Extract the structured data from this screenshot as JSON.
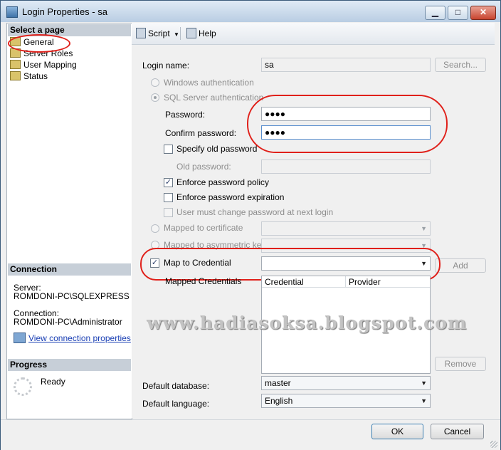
{
  "window": {
    "title": "Login Properties - sa",
    "minimize": "▁",
    "maximize": "□",
    "close": "✕"
  },
  "left_panel": {
    "select_page_header": "Select a page",
    "pages": [
      {
        "label": "General"
      },
      {
        "label": "Server Roles"
      },
      {
        "label": "User Mapping"
      },
      {
        "label": "Status"
      }
    ],
    "connection_header": "Connection",
    "server_label": "Server:",
    "server_value": "ROMDONI-PC\\SQLEXPRESS",
    "connection_label": "Connection:",
    "connection_value": "ROMDONI-PC\\Administrator",
    "view_link": "View connection properties",
    "progress_header": "Progress",
    "progress_status": "Ready"
  },
  "toolbar": {
    "script": "Script",
    "help": "Help",
    "dropdown_arrow": "▼"
  },
  "form": {
    "login_name_label": "Login name:",
    "login_name_value": "sa",
    "search_button": "Search...",
    "windows_auth": "Windows authentication",
    "sql_auth": "SQL Server authentication",
    "password_label": "Password:",
    "password_value": "●●●●",
    "confirm_label": "Confirm password:",
    "confirm_value": "●●●●",
    "specify_old": "Specify old password",
    "old_password_label": "Old password:",
    "enforce_policy": "Enforce password policy",
    "enforce_expiration": "Enforce password expiration",
    "must_change": "User must change password at next login",
    "map_cert": "Mapped to certificate",
    "map_asym": "Mapped to asymmetric key",
    "map_credential": "Map to Credential",
    "add_button": "Add",
    "mapped_credentials_label": "Mapped Credentials",
    "grid_cols": [
      "Credential",
      "Provider"
    ],
    "remove_button": "Remove",
    "default_db_label": "Default database:",
    "default_db_value": "master",
    "default_lang_label": "Default language:",
    "default_lang_value": "English",
    "check_mark": "✓",
    "combo_arrow": "▼"
  },
  "watermark": "www.hadiasoksa.blogspot.com",
  "footer": {
    "ok": "OK",
    "cancel": "Cancel"
  },
  "colors": {
    "annotation_red": "#e0201a",
    "link_blue": "#1a3fb4"
  }
}
